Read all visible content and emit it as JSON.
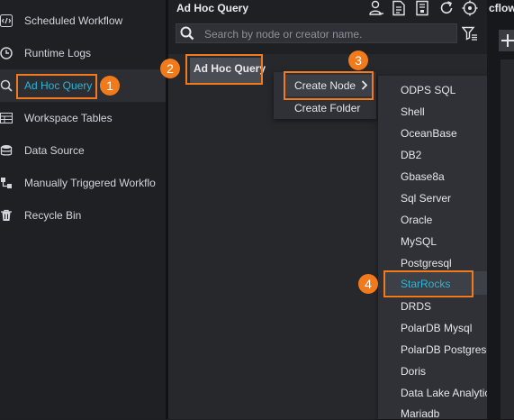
{
  "sidebar": {
    "items": [
      {
        "label": "Scheduled Workflow",
        "icon": "code-icon"
      },
      {
        "label": "Runtime Logs",
        "icon": "clock-icon"
      },
      {
        "label": "Ad Hoc Query",
        "icon": "search-icon"
      },
      {
        "label": "Workspace Tables",
        "icon": "table-icon"
      },
      {
        "label": "Data Source",
        "icon": "database-icon"
      },
      {
        "label": "Manually Triggered Workflo",
        "icon": "manual-workflow-icon"
      },
      {
        "label": "Recycle Bin",
        "icon": "trash-icon"
      }
    ]
  },
  "panel": {
    "title": "Ad Hoc Query",
    "search_placeholder": "Search by node or creator name.",
    "tree_node_label": "Ad Hoc Query"
  },
  "context_menu": {
    "items": [
      {
        "label": "Create Node"
      },
      {
        "label": "Create Folder"
      }
    ]
  },
  "submenu": {
    "items": [
      {
        "label": "ODPS SQL"
      },
      {
        "label": "Shell"
      },
      {
        "label": "OceanBase"
      },
      {
        "label": "DB2"
      },
      {
        "label": "Gbase8a"
      },
      {
        "label": "Sql Server"
      },
      {
        "label": "Oracle"
      },
      {
        "label": "MySQL"
      },
      {
        "label": "Postgresql"
      },
      {
        "label": "StarRocks"
      },
      {
        "label": "DRDS"
      },
      {
        "label": "PolarDB Mysql"
      },
      {
        "label": "PolarDB Postgresql"
      },
      {
        "label": "Doris"
      },
      {
        "label": "Data Lake Analytics"
      },
      {
        "label": "Mariadb"
      }
    ]
  },
  "right_strip": {
    "tab_label": "cflow",
    "plus_icon": "plus-icon"
  },
  "annotations": {
    "steps": [
      "1",
      "2",
      "3",
      "4"
    ],
    "accent_color": "#f07a1c"
  },
  "colors": {
    "active_text": "#27b6d8",
    "background": "#1e1f23"
  }
}
